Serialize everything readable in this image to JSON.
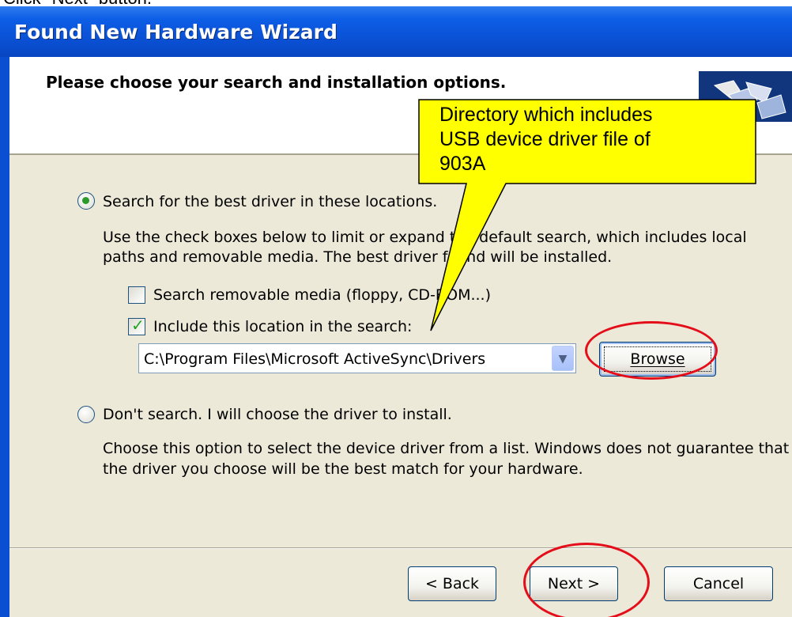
{
  "caption": "Click \"Next\" button.",
  "window": {
    "title": "Found New Hardware Wizard"
  },
  "header": {
    "title": "Please choose your search and installation options."
  },
  "options": {
    "search_radio": {
      "label": "Search for the best driver in these locations.",
      "selected": true,
      "description_line1": "Use the check boxes below to limit or expand the default search, which includes local",
      "description_line2": "paths and removable media. The best driver found will be installed."
    },
    "removable_media": {
      "label": "Search removable media (floppy, CD-ROM...)",
      "checked": false
    },
    "include_location": {
      "label": "Include this location in the search:",
      "checked": true
    },
    "location_value": "C:\\Program Files\\Microsoft ActiveSync\\Drivers",
    "browse_label": "Browse",
    "dont_search_radio": {
      "label": "Don't search. I will choose the driver to install.",
      "selected": false,
      "description_line1": "Choose this option to select the device driver from a list.  Windows does not guarantee that",
      "description_line2": "the driver you choose will be the best match for your hardware."
    }
  },
  "footer": {
    "back_label": "< Back",
    "next_label": "Next >",
    "cancel_label": "Cancel"
  },
  "callout": {
    "line1": "Directory which includes",
    "line2": "USB device driver file of",
    "line3": "903A",
    "fill_color": "#ffff00"
  },
  "colors": {
    "titlebar": "#0a4fd2",
    "dialog_bg": "#ece9d8",
    "highlight": "#e40e1a"
  }
}
